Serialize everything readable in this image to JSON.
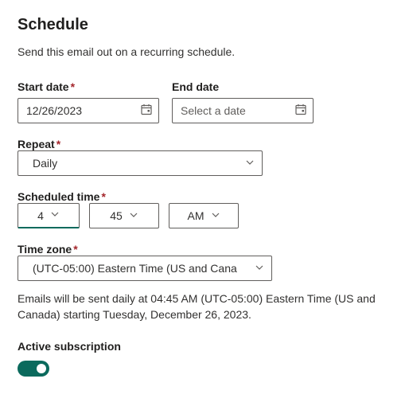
{
  "header": {
    "title": "Schedule",
    "description": "Send this email out on a recurring schedule."
  },
  "startDate": {
    "label": "Start date",
    "required": "*",
    "value": "12/26/2023"
  },
  "endDate": {
    "label": "End date",
    "placeholder": "Select a date",
    "value": ""
  },
  "repeat": {
    "label": "Repeat",
    "required": "*",
    "value": "Daily"
  },
  "scheduledTime": {
    "label": "Scheduled time",
    "required": "*",
    "hour": "4",
    "minute": "45",
    "ampm": "AM"
  },
  "timezone": {
    "label": "Time zone",
    "required": "*",
    "value": "(UTC-05:00) Eastern Time (US and Cana"
  },
  "summary": "Emails will be sent daily at 04:45 AM (UTC-05:00) Eastern Time (US and Canada) starting Tuesday, December 26, 2023.",
  "activeSubscription": {
    "label": "Active subscription",
    "enabled": true
  }
}
